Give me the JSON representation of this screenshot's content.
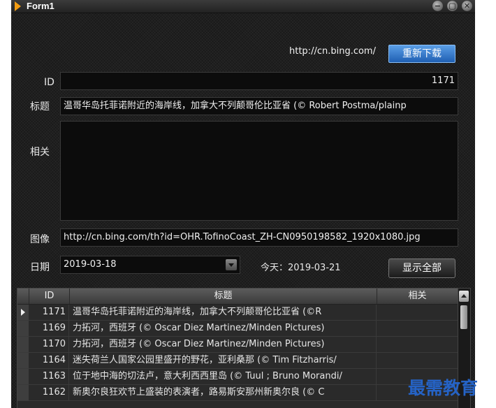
{
  "window": {
    "title": "Form1",
    "minimize": "−",
    "restore": "▢",
    "close": "✕"
  },
  "header": {
    "url": "http://cn.bing.com/",
    "redownload_label": "重新下载"
  },
  "form": {
    "id_label": "ID",
    "id_value": "1171",
    "title_label": "标题",
    "title_value": "温哥华岛托菲诺附近的海岸线，加拿大不列颠哥伦比亚省 (© Robert Postma/plainp",
    "related_label": "相关",
    "related_value": "",
    "image_label": "图像",
    "image_value": "http://cn.bing.com/th?id=OHR.TofinoCoast_ZH-CN0950198582_1920x1080.jpg",
    "date_label": "日期",
    "date_value": "2019-03-18",
    "today_text": "今天：2019-03-21",
    "show_all_label": "显示全部"
  },
  "grid": {
    "columns": [
      "ID",
      "标题",
      "相关"
    ],
    "rows": [
      {
        "id": "1171",
        "title": "温哥华岛托菲诺附近的海岸线，加拿大不列颠哥伦比亚省 (©R",
        "related": "",
        "selected": true
      },
      {
        "id": "1169",
        "title": "力拓河，西班牙 (© Oscar Diez Martinez/Minden Pictures)",
        "related": ""
      },
      {
        "id": "1170",
        "title": "力拓河，西班牙 (© Oscar Diez Martinez/Minden Pictures)",
        "related": ""
      },
      {
        "id": "1164",
        "title": "迷失荷兰人国家公园里盛开的野花，亚利桑那 (© Tim Fitzharris/",
        "related": ""
      },
      {
        "id": "1163",
        "title": "位于地中海的切法卢，意大利西西里岛 (© Tuul ; Bruno Morandi/",
        "related": ""
      },
      {
        "id": "1162",
        "title": "新奥尔良狂欢节上盛装的表演者，路易斯安那州新奥尔良 (© C",
        "related": ""
      }
    ]
  },
  "watermark": "最需教育",
  "colors": {
    "accent_blue": "#2f74cf",
    "background": "#1f1f1f",
    "watermark": "#2563c6"
  }
}
